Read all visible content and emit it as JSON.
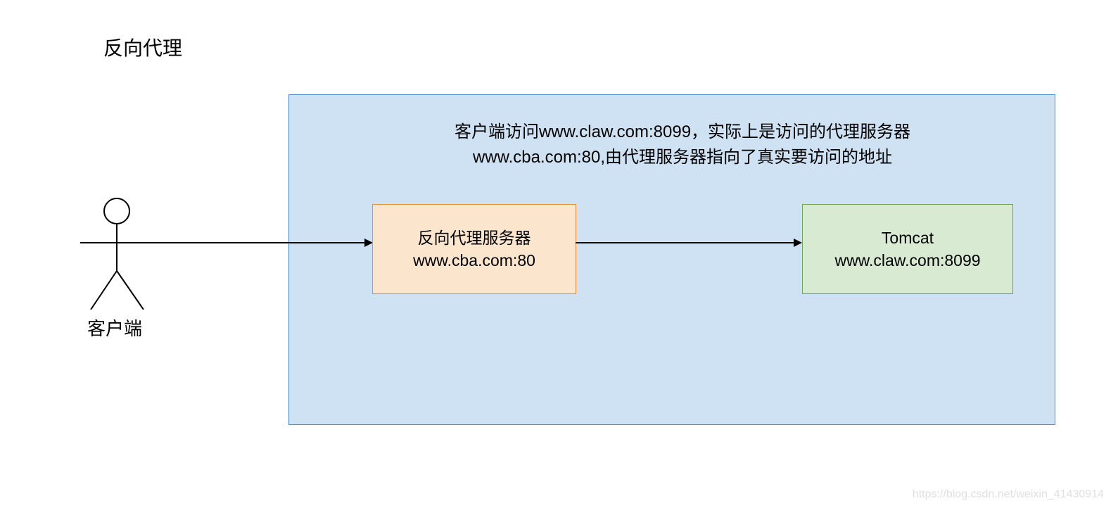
{
  "title": "反向代理",
  "client": {
    "label": "客户端"
  },
  "description": {
    "line1": "客户端访问www.claw.com:8099，实际上是访问的代理服务器",
    "line2": "www.cba.com:80,由代理服务器指向了真实要访问的地址"
  },
  "proxy": {
    "label": "反向代理服务器",
    "address": "www.cba.com:80"
  },
  "tomcat": {
    "label": "Tomcat",
    "address": "www.claw.com:8099"
  },
  "watermark": "https://blog.csdn.net/weixin_41430914"
}
